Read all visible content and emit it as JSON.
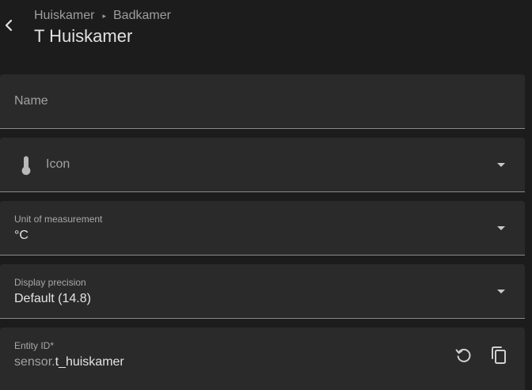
{
  "header": {
    "breadcrumb": [
      "Huiskamer",
      "Badkamer"
    ],
    "breadcrumb_separator": "▸",
    "title": "T Huiskamer"
  },
  "fields": {
    "name": {
      "placeholder": "Name"
    },
    "icon": {
      "placeholder": "Icon",
      "icon": "thermometer-icon"
    },
    "unit": {
      "label": "Unit of measurement",
      "value": "°C"
    },
    "precision": {
      "label": "Display precision",
      "value": "Default (14.8)"
    },
    "entity_id": {
      "label": "Entity ID*",
      "prefix": "sensor.",
      "value": "t_huiskamer"
    }
  },
  "icons": {
    "back": "chevron-left-icon",
    "restore": "restore-icon",
    "copy": "copy-icon"
  },
  "colors": {
    "background": "#1c1c1c",
    "field_background": "#2a2a2a",
    "text_primary": "#e1e1e1",
    "text_secondary": "#9e9e9e"
  }
}
